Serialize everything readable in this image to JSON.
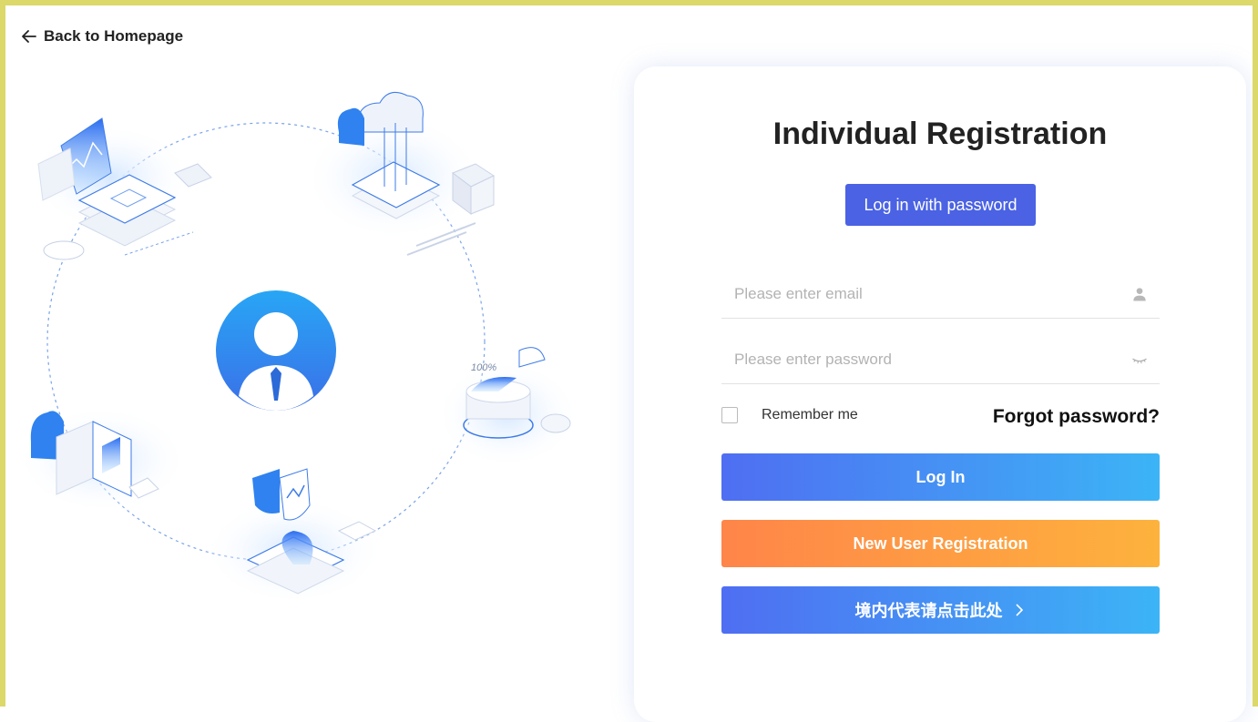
{
  "header": {
    "back_label": "Back to Homepage",
    "back_icon": "arrow-left-icon"
  },
  "illustration": {
    "center_icon": "user-avatar-icon",
    "percent_label": "100%",
    "nodes": [
      "laptop-chart-icon",
      "cloud-server-icon",
      "database-pie-icon",
      "shield-check-icon",
      "video-camera-icon"
    ]
  },
  "form": {
    "title": "Individual Registration",
    "mode_button": "Log in with password",
    "email_placeholder": "Please enter email",
    "password_placeholder": "Please enter password",
    "email_icon": "user-icon",
    "password_icon": "eye-closed-icon",
    "remember_label": "Remember me",
    "forgot_label": "Forgot password?",
    "login_button": "Log In",
    "register_button": "New User Registration",
    "domestic_button": "境内代表请点击此处",
    "domestic_icon": "chevron-right-icon"
  },
  "colors": {
    "frame": "#dcd86a",
    "primary": "#4a62e3",
    "login_gradient": [
      "#4f6ef2",
      "#3cb4f6"
    ],
    "register_gradient": [
      "#ff8549",
      "#fdb23d"
    ]
  }
}
